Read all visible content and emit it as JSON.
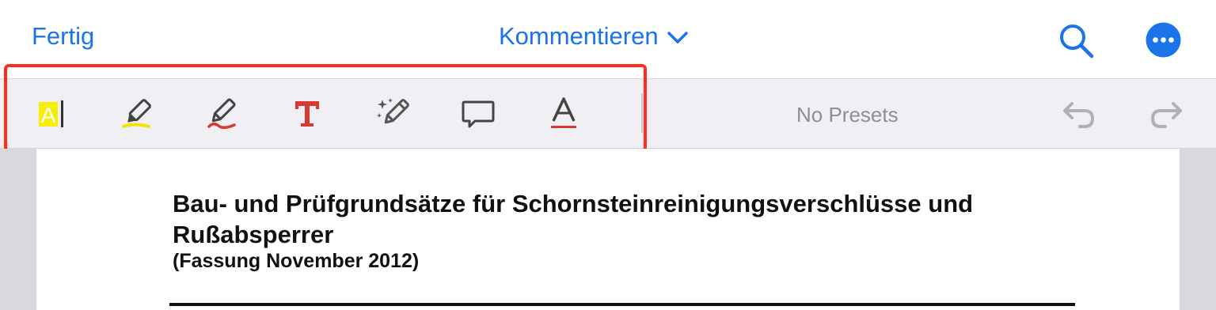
{
  "topbar": {
    "done_label": "Fertig",
    "mode_label": "Kommentieren",
    "search_icon": "search-icon",
    "more_icon": "more-options-icon",
    "accent_color": "#1a73e8"
  },
  "toolbar": {
    "tools": [
      {
        "id": "text-highlight",
        "icon": "text-highlight-icon",
        "color": "#f6f000"
      },
      {
        "id": "highlighter",
        "icon": "highlighter-pen-icon",
        "color": "#f2e400"
      },
      {
        "id": "pen",
        "icon": "pen-icon",
        "color": "#d93a2f"
      },
      {
        "id": "text",
        "icon": "text-tool-icon",
        "color": "#d93a2f"
      },
      {
        "id": "magic-pen",
        "icon": "magic-pen-icon",
        "color": "#555555"
      },
      {
        "id": "comment",
        "icon": "comment-icon",
        "color": "#555555"
      },
      {
        "id": "text-color",
        "icon": "text-color-icon",
        "color": "#d93a2f"
      }
    ],
    "presets_label": "No Presets",
    "undo_icon": "undo-icon",
    "redo_icon": "redo-icon",
    "selection_outline_color": "#ff2d1c"
  },
  "document": {
    "title": "Bau- und Prüfgrundsätze für Schornsteinreinigungsverschlüsse und Rußabsperrer",
    "subtitle": "(Fassung November 2012)"
  }
}
